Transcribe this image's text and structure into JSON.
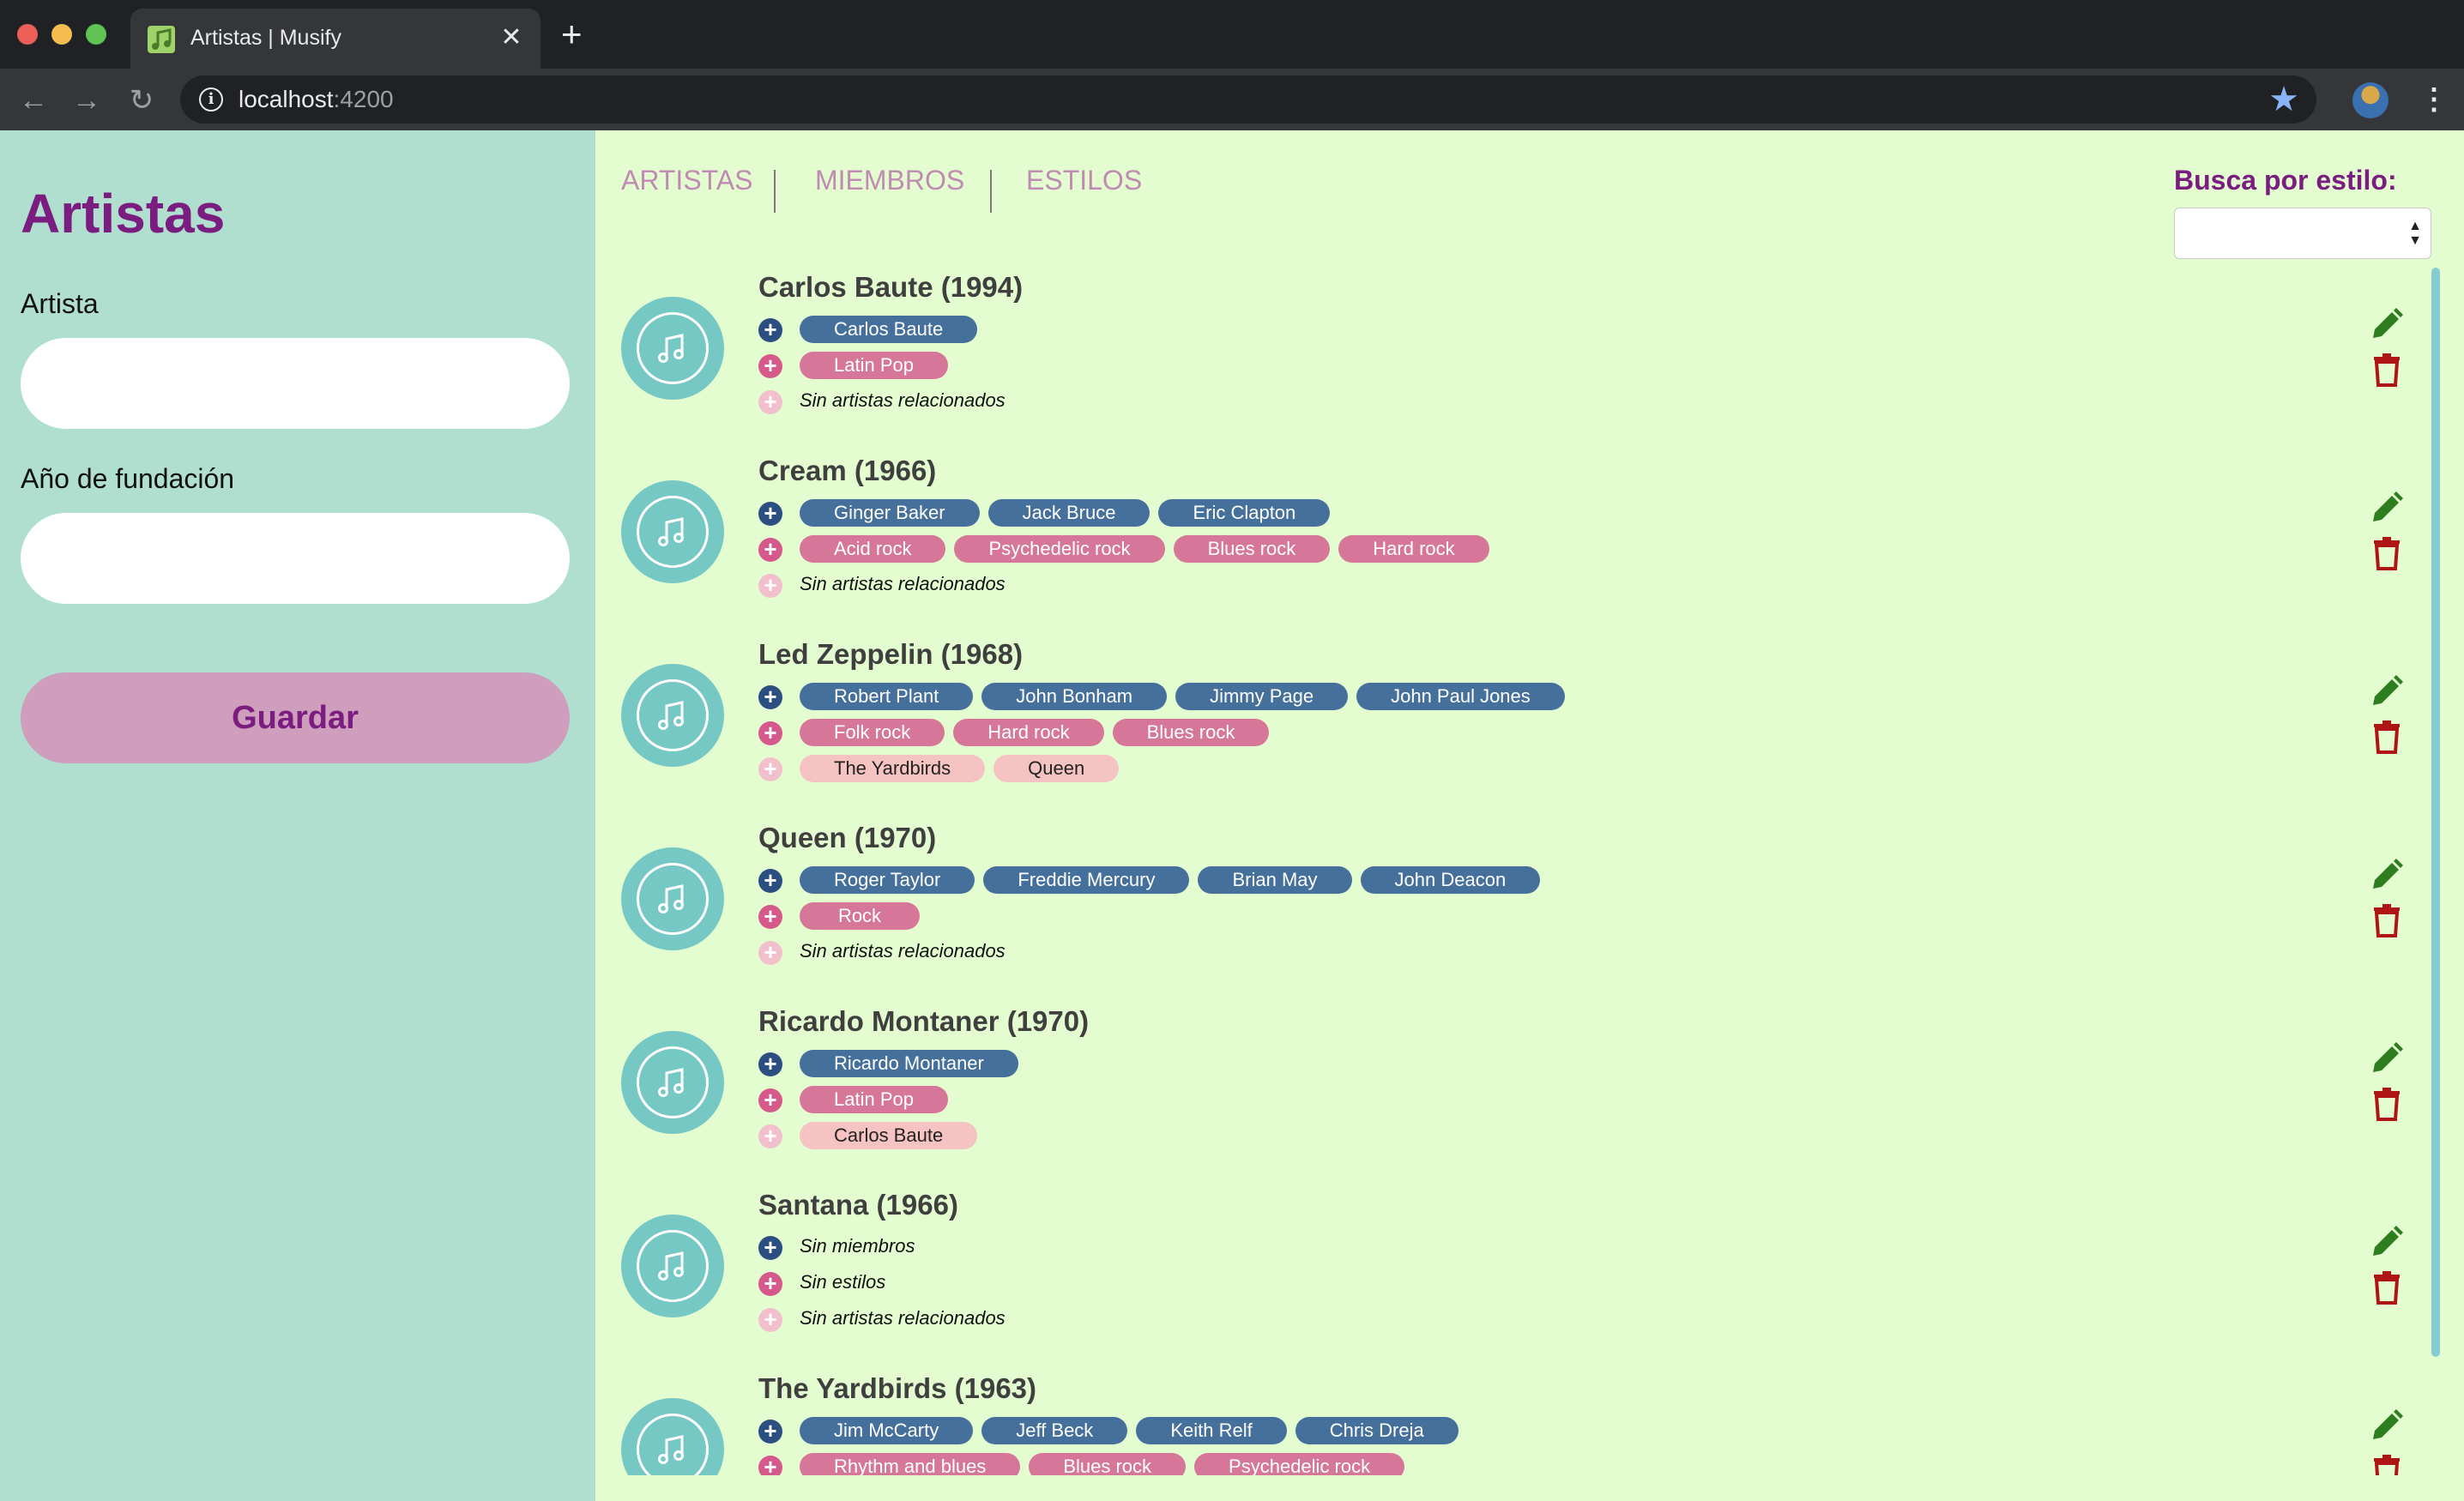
{
  "browser": {
    "tab_title": "Artistas | Musify",
    "tab_close": "✕",
    "new_tab": "+",
    "url_host": "localhost",
    "url_port": ":4200",
    "back": "←",
    "forward": "→",
    "reload": "↻",
    "star": "★",
    "menu": "⋮",
    "info": "i"
  },
  "sidebar": {
    "title": "Artistas",
    "artist_label": "Artista",
    "artist_value": "",
    "year_label": "Año de fundación",
    "year_value": "",
    "save_label": "Guardar"
  },
  "nav": {
    "links": [
      "ARTISTAS",
      "MIEMBROS",
      "ESTILOS"
    ]
  },
  "filter": {
    "label": "Busca por estilo:",
    "selected": ""
  },
  "artists": [
    {
      "title": "Carlos Baute (1994)",
      "members": [
        "Carlos Baute"
      ],
      "styles": [
        "Latin Pop"
      ],
      "related": [],
      "no_related": "Sin artistas relacionados"
    },
    {
      "title": "Cream (1966)",
      "members": [
        "Ginger Baker",
        "Jack Bruce",
        "Eric Clapton"
      ],
      "styles": [
        "Acid rock",
        "Psychedelic rock",
        "Blues rock",
        "Hard rock"
      ],
      "related": [],
      "no_related": "Sin artistas relacionados"
    },
    {
      "title": "Led Zeppelin (1968)",
      "members": [
        "Robert Plant",
        "John Bonham",
        "Jimmy Page",
        "John Paul Jones"
      ],
      "styles": [
        "Folk rock",
        "Hard rock",
        "Blues rock"
      ],
      "related": [
        "The Yardbirds",
        "Queen"
      ]
    },
    {
      "title": "Queen (1970)",
      "members": [
        "Roger Taylor",
        "Freddie Mercury",
        "Brian May",
        "John Deacon"
      ],
      "styles": [
        "Rock"
      ],
      "related": [],
      "no_related": "Sin artistas relacionados"
    },
    {
      "title": "Ricardo Montaner (1970)",
      "members": [
        "Ricardo Montaner"
      ],
      "styles": [
        "Latin Pop"
      ],
      "related": [
        "Carlos Baute"
      ]
    },
    {
      "title": "Santana (1966)",
      "members": [],
      "no_members": "Sin miembros",
      "styles": [],
      "no_styles": "Sin estilos",
      "related": [],
      "no_related": "Sin artistas relacionados"
    },
    {
      "title": "The Yardbirds (1963)",
      "members": [
        "Jim McCarty",
        "Jeff Beck",
        "Keith Relf",
        "Chris Dreja"
      ],
      "styles": [
        "Rhythm and blues",
        "Blues rock",
        "Psychedelic rock"
      ],
      "related": []
    }
  ],
  "colors": {
    "sidebar_bg": "#b0dfcf",
    "main_bg": "#e4fdd0",
    "accent_purple": "#7a1c80",
    "member_chip": "#45709c",
    "style_chip": "#d6779a",
    "related_chip": "#f5c3c1",
    "edit_icon": "#2e7d1e",
    "delete_icon": "#b01515"
  },
  "icons": {
    "artist_avatar": "music-note-icon",
    "edit": "pencil-icon",
    "delete": "trash-icon",
    "add_member": "plus-circle-icon",
    "add_style": "plus-circle-icon",
    "add_related": "plus-circle-icon"
  }
}
